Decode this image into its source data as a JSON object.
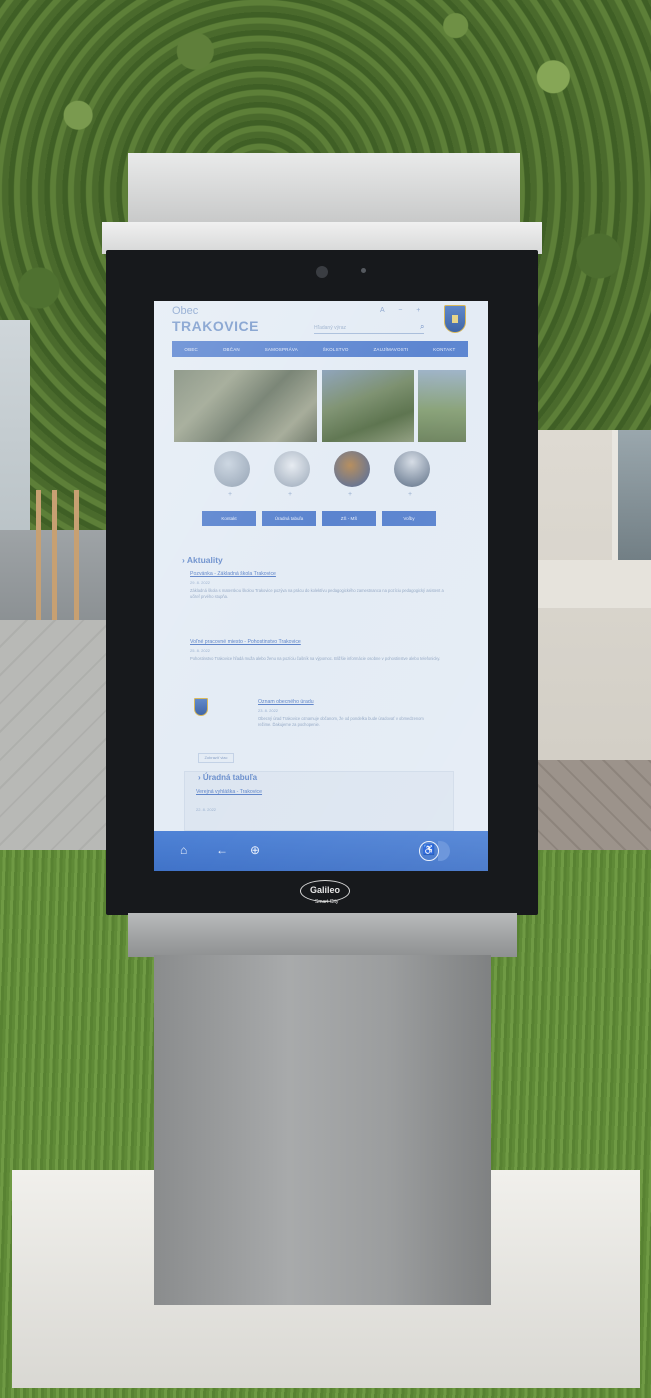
{
  "screen": {
    "header": {
      "obec": "Obec",
      "municipality": "TRAKOVICE",
      "search_placeholder": "Hľadaný výraz"
    },
    "nav": [
      "OBEC",
      "OBČAN",
      "SAMOSPRÁVA",
      "ŠKOLSTVO",
      "ZAUJÍMAVOSTI",
      "KONTAKT"
    ],
    "tiles": [
      {
        "label": "Kontakt"
      },
      {
        "label": "Úradná tabuľa"
      },
      {
        "label": "ZŠ - MŠ"
      },
      {
        "label": "Voľby"
      }
    ],
    "news": {
      "title": "Aktuality",
      "items": [
        {
          "link": "Pozvánka - Základná škola Trakovice",
          "date": "29. 8. 2022",
          "text": "Základná škola s materskou školou Trakovice pozýva na prácu do kolektívu pedagogického zamestnanca na pozíciu pedagogický asistent a učiteľ prvého stupňa."
        },
        {
          "link": "Voľné pracovné miesto - Pohostinstvo Trakovice",
          "date": "25. 8. 2022",
          "text": "Pohostinstvo Trakovice hľadá muža alebo ženu na pozíciu čašník na výpomoc. Bližšie informácie osobne v pohostinstve alebo telefonicky."
        },
        {
          "link": "Oznam obecného úradu",
          "date": "23. 8. 2022",
          "text": "Obecný úrad Trakovice oznamuje občanom, že od pondelka bude úradovať v obmedzenom režime. Ďakujeme za pochopenie."
        }
      ],
      "more_label": "Zobraziť viac"
    },
    "board": {
      "title": "Úradná tabuľa",
      "link": "Verejná vyhláška - Trakovice",
      "date": "22. 8. 2022"
    },
    "bottom_bar": {
      "icons": [
        "home-icon",
        "back-icon",
        "zoom-icon"
      ],
      "accessibility_icon": "wheelchair-icon"
    }
  },
  "kiosk": {
    "brand": "Galileo",
    "brand_sub": "Smart City"
  },
  "colors": {
    "screen_accent": "#5b84cf",
    "screen_bg": "#e4ecf5",
    "bezel": "#17191c"
  }
}
